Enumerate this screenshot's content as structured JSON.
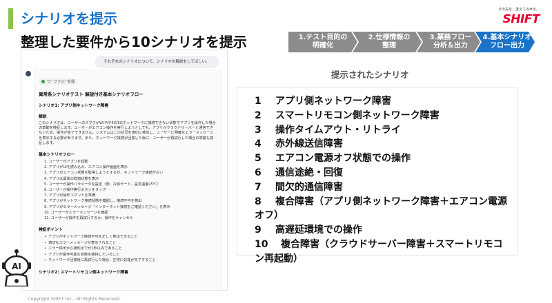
{
  "header": {
    "title": "シナリオを提示",
    "subtitle": "整理した要件から10シナリオを提示"
  },
  "logo": {
    "tagline": "その先を、変えてみせる。",
    "wordmark": "SHIFT"
  },
  "steps": [
    {
      "label": "1.テスト目的の\n明確化",
      "active": false
    },
    {
      "label": "2.仕様情報の\n整理",
      "active": false
    },
    {
      "label": "3.業務フロー\n分析＆出力",
      "active": false
    },
    {
      "label": "4.基本シナリオ\nフロー出力",
      "active": true
    }
  ],
  "colors": {
    "accent_green": "#8bc34a",
    "title_blue": "#1a73c8",
    "step_inactive": "#8c8c8c",
    "step_active": "#1a73c8",
    "brand_red": "#e6002d"
  },
  "chat": {
    "user_message": "それぞれのシナリオについて、シナリオの解説をしてほしい。",
    "badge": "ワークフロー処理",
    "doc_title": "異常系シナリオテスト 解説付き基本シナリオフロー",
    "scenario1_heading": "シナリオ1: アプリ側ネットワーク障害",
    "explain_heading": "解説",
    "explain_text": "このシナリオは、ユーザーのスマホがWi-Fiや4G/5Gネットワークに接続できない状態でアプリを操作した場合の挙動を検証します。ユーザーがエアコン操作を実行しようとしても、アプリがクラウドサーバーと通信できないため、操作が完了できません。システムはこの状況を適切に検出し、ユーザーに明確なエラーメッセージを表示する必要があります。また、ネットワーク接続が回復した後に、ユーザーが再試行した場合の挙動も検証します。",
    "flow_heading": "基本シナリオフロー",
    "flow_steps": [
      "1. ユーザーがアプリを起動",
      "2. アプリがUIを読み込み、エアコン操作画面を表示",
      "3. アプリがエアコン状態を取得しようとするが、ネットワーク接続がない",
      "4. アプリは最後の既知状態を表示",
      "5. ユーザーが操作パラメータを設定（例：冷房モード、設定温度25℃）",
      "6. ユーザーが操作実行ボタンをタップ",
      "7. アプリが操作コマンドを準備",
      "8. アプリがネットワーク接続状態を確認し、接続不可を検出",
      "9. アプリがエラーメッセージ「インターネット接続をご確認ください」を表示",
      "10. ユーザーがエラーメッセージを確認",
      "11. ユーザーが操作を再試行するか、操作をキャンセル"
    ],
    "check_heading": "検証ポイント",
    "check_points": [
      "アプリがネットワーク接続不可を正しく検出できること",
      "適切なエラーメッセージが表示されること",
      "エラー検出から通知までが1秒以内であること",
      "アプリが操作可能な状態を維持していること",
      "ネットワーク回復後に再試行した場合、正常に処理が完了すること"
    ],
    "scenario2_heading": "シナリオ2: スマートリモコン側ネットワーク障害"
  },
  "scenario_list": {
    "heading": "提示されたシナリオ",
    "items": [
      {
        "num": "1",
        "text": "アプリ側ネットワーク障害"
      },
      {
        "num": "2",
        "text": "スマートリモコン側ネットワーク障害"
      },
      {
        "num": "3",
        "text": "操作タイムアウト・リトライ"
      },
      {
        "num": "4",
        "text": "赤外線送信障害"
      },
      {
        "num": "5",
        "text": "エアコン電源オフ状態での操作"
      },
      {
        "num": "6",
        "text": "通信途絶・回復"
      },
      {
        "num": "7",
        "text": "間欠的通信障害"
      },
      {
        "num": "8",
        "text": "複合障害（アプリ側ネットワーク障害＋エアコン電源オフ）"
      },
      {
        "num": "9",
        "text": "高遅延環境での操作"
      },
      {
        "num": "10",
        "text": "複合障害（クラウドサーバー障害＋スマートリモコン再起動）"
      }
    ]
  },
  "footer": {
    "copyright": "Copyright SHIFT Inc., All Rights Reserved.",
    "robot_label": "AI"
  }
}
